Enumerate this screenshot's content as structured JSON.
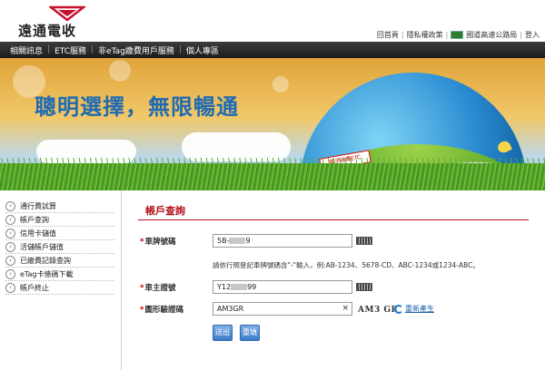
{
  "header": {
    "logo_text": "遠通電收",
    "toplinks": [
      "回首頁",
      "隱私權政策",
      "國道高速公路局",
      "登入"
    ]
  },
  "nav": {
    "items": [
      "相關訊息",
      "ETC服務",
      "非eTag繳費用戶服務",
      "個人專區"
    ]
  },
  "banner": {
    "title": "聰明選擇，無限暢通",
    "sign_text": "電子收費ETC"
  },
  "sidebar": {
    "items": [
      "通行費試算",
      "帳戶查詢",
      "信用卡儲值",
      "活儲帳戶儲值",
      "已繳費記錄查詢",
      "eTag卡條碼下載",
      "帳戶終止"
    ]
  },
  "form": {
    "title": "帳戶查詢",
    "plate_label": "車牌號碼",
    "plate_value_start": "5B-",
    "plate_value_end": "9",
    "hint": "請依行照登記車牌號碼含\"-\"輸入，例:AB-1234、5678-CD、ABC-1234或1234-ABC。",
    "id_label": "車主證號",
    "id_value_start": "Y12",
    "id_value_end": "99",
    "captcha_label": "圖形驗證碼",
    "captcha_value": "AM3GR",
    "captcha_image_text": "AM3 GR",
    "clear_symbol": "×",
    "refresh_label": "重新產生",
    "submit_label": "送出",
    "reset_label": "重填"
  },
  "colors": {
    "accent_red": "#b5121b",
    "nav_bg": "#2a2a2a",
    "banner_title": "#1f6bb3",
    "button_blue": "#3b7ccc"
  }
}
